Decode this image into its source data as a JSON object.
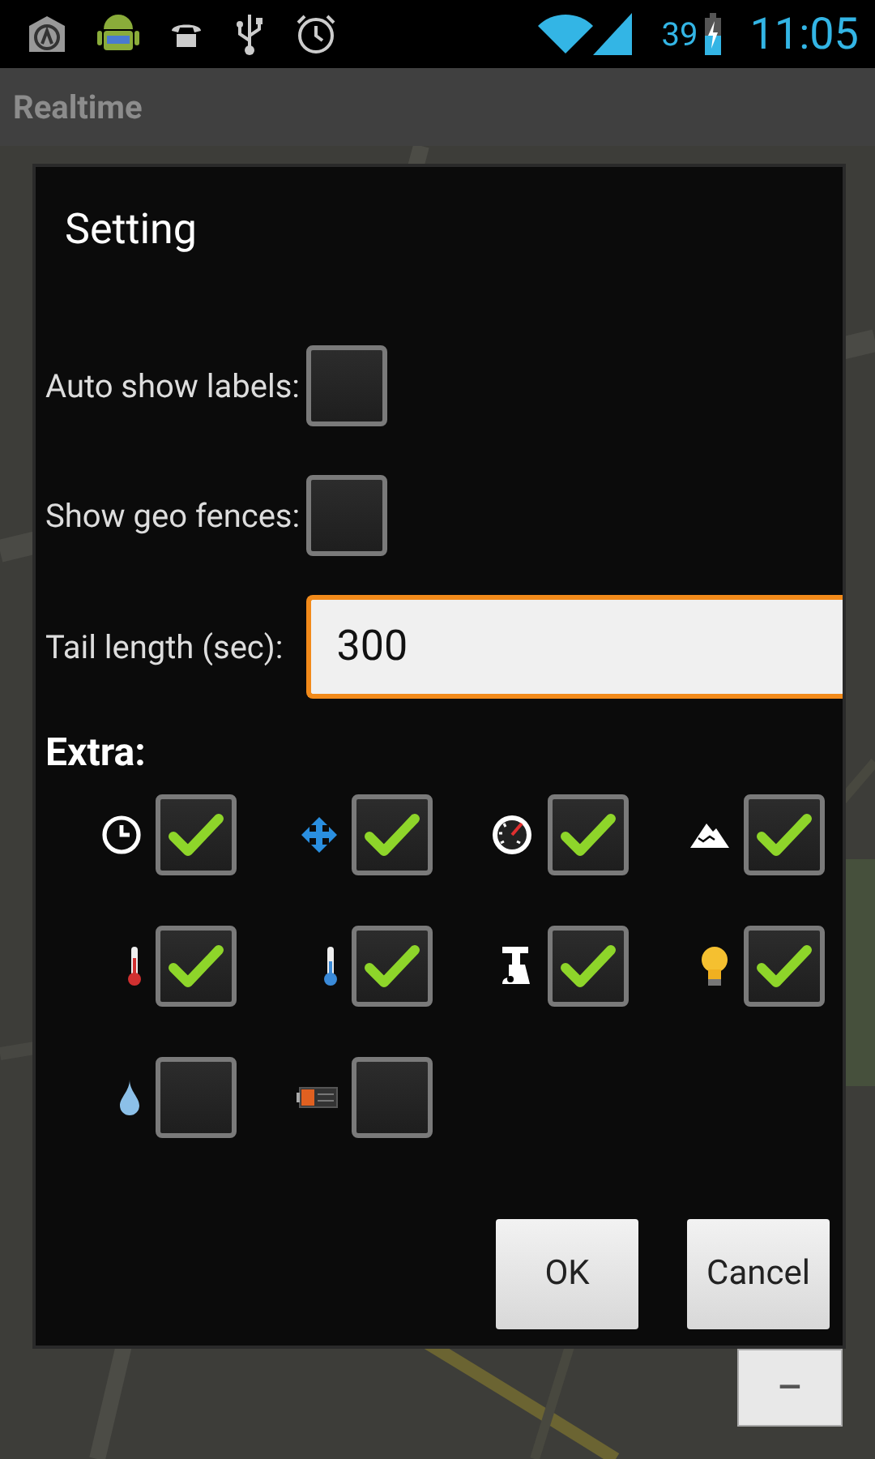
{
  "status_bar": {
    "battery": "39",
    "time": "11:05"
  },
  "action_bar": {
    "title": "Realtime"
  },
  "dialog": {
    "title": "Setting",
    "options": [
      {
        "label": "Auto show labels:",
        "checked": false
      },
      {
        "label": "Show geo fences:",
        "checked": false
      }
    ],
    "tail_length": {
      "label": "Tail length (sec):",
      "value": "300",
      "focused": true
    },
    "extra": {
      "label": "Extra:",
      "items": [
        {
          "kind": "clock",
          "checked": true
        },
        {
          "kind": "move",
          "checked": true
        },
        {
          "kind": "speed",
          "checked": true
        },
        {
          "kind": "altitude",
          "checked": true
        },
        {
          "kind": "temperature",
          "checked": true
        },
        {
          "kind": "cold",
          "checked": true
        },
        {
          "kind": "valve",
          "checked": true
        },
        {
          "kind": "light",
          "checked": true
        },
        {
          "kind": "drop",
          "checked": false
        },
        {
          "kind": "battery",
          "checked": false
        }
      ]
    },
    "buttons": [
      "OK",
      "Cancel"
    ]
  },
  "zoom_out": {
    "label": "−"
  }
}
